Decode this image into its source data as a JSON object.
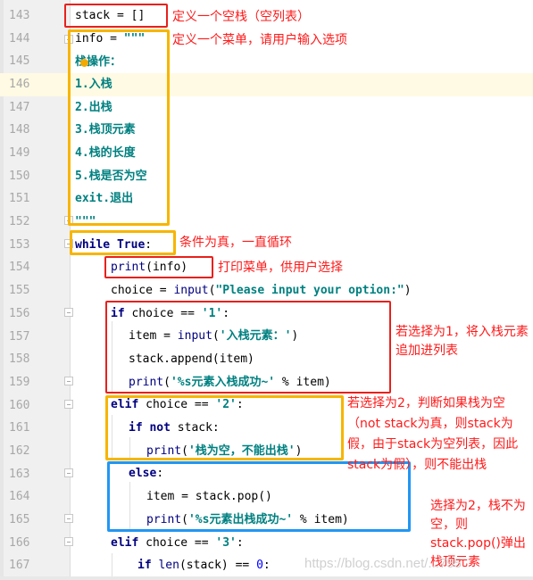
{
  "editor": {
    "current_line": 146,
    "lines": [
      {
        "num": "143",
        "code": "stack = []"
      },
      {
        "num": "144",
        "code": "info = \"\"\""
      },
      {
        "num": "145",
        "code": "栈操作："
      },
      {
        "num": "146",
        "code": "1.入栈"
      },
      {
        "num": "147",
        "code": "2.出栈"
      },
      {
        "num": "148",
        "code": "3.栈顶元素"
      },
      {
        "num": "149",
        "code": "4.栈的长度"
      },
      {
        "num": "150",
        "code": "5.栈是否为空"
      },
      {
        "num": "151",
        "code": "exit.退出"
      },
      {
        "num": "152",
        "code": "\"\"\""
      },
      {
        "num": "153",
        "code": "while True:"
      },
      {
        "num": "154",
        "code": "print(info)"
      },
      {
        "num": "155",
        "code": "choice = input(\"Please input your option:\")"
      },
      {
        "num": "156",
        "code": "if choice == '1':"
      },
      {
        "num": "157",
        "code": "item = input('入栈元素：')"
      },
      {
        "num": "158",
        "code": "stack.append(item)"
      },
      {
        "num": "159",
        "code": "print('%s元素入栈成功~' % item)"
      },
      {
        "num": "160",
        "code": "elif choice == '2':"
      },
      {
        "num": "161",
        "code": "if not stack:"
      },
      {
        "num": "162",
        "code": "print('栈为空，不能出栈')"
      },
      {
        "num": "163",
        "code": "else:"
      },
      {
        "num": "164",
        "code": "item = stack.pop()"
      },
      {
        "num": "165",
        "code": "print('%s元素出栈成功~' % item)"
      },
      {
        "num": "166",
        "code": "elif choice == '3':"
      },
      {
        "num": "167",
        "code": "if len(stack) == 0:"
      }
    ],
    "tokens": {
      "l143": "stack = []",
      "l144a": "info = ",
      "l144b": "\"\"\"",
      "l154a": "print",
      "l154b": "(info)",
      "l155a": "choice = ",
      "l155b": "input",
      "l155c": "(",
      "l155d": "\"Please input your option:\"",
      "l155e": ")",
      "l156a": "if",
      "l156b": " choice == ",
      "l156c": "'1'",
      "l156d": ":",
      "l157a": "item = ",
      "l157b": "input",
      "l157c": "(",
      "l157d": "'入栈元素：'",
      "l157e": ")",
      "l158": "stack.append(item)",
      "l159a": "print",
      "l159b": "(",
      "l159c": "'%s元素入栈成功~'",
      "l159d": " % item)",
      "l160a": "elif",
      "l160b": " choice == ",
      "l160c": "'2'",
      "l160d": ":",
      "l161a": "if not",
      "l161b": " stack:",
      "l162a": "print",
      "l162b": "(",
      "l162c": "'栈为空，不能出栈'",
      "l162d": ")",
      "l163a": "else",
      "l163b": ":",
      "l164": "item = stack.pop()",
      "l165a": "print",
      "l165b": "(",
      "l165c": "'%s元素出栈成功~'",
      "l165d": " % item)",
      "l166a": "elif",
      "l166b": " choice == ",
      "l166c": "'3'",
      "l166d": ":",
      "l167a": "if",
      "l167b": " len",
      "l167c": "(stack) == ",
      "l167d": "0",
      "l167e": ":",
      "l153a": "while True",
      "l153b": ":"
    }
  },
  "annotations": {
    "empty_stack": "定义一个空栈（空列表）",
    "menu": "定义一个菜单，请用户输入选项",
    "loop": "条件为真，一直循环",
    "print_menu": "打印菜单，供用户选择",
    "push": "若选择为1，将入栈元素追加进列表",
    "pop_empty": "若选择为2，判断如果栈为空（not stack为真，则stack为假，由于stack为空列表，因此stack为假），则不能出栈",
    "pop_nonempty": "选择为2，栈不为空，则stack.pop()弹出栈顶元素"
  },
  "watermark": "https://blog.csdn.net/...755",
  "colors": {
    "annotation_red": "#e8201c",
    "annotation_yellow": "#f7b500",
    "annotation_blue": "#2196f3",
    "annotation_text": "#ff1a1a"
  }
}
